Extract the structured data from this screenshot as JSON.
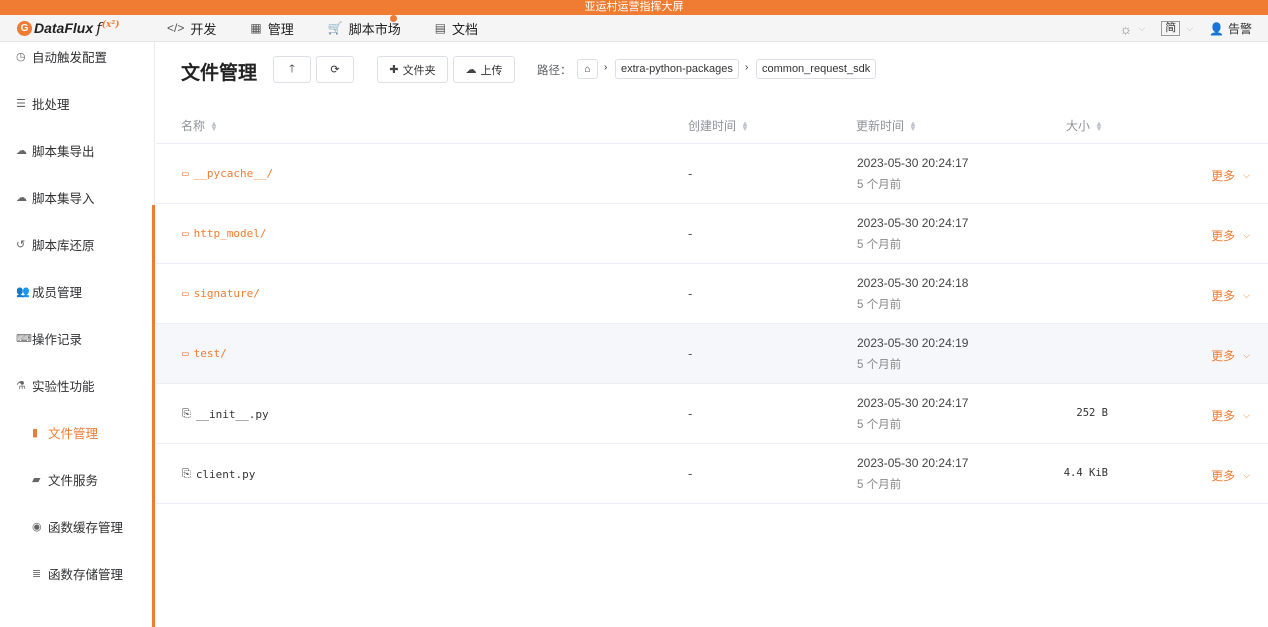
{
  "banner": "亚运村运营指挥大屏",
  "app": {
    "brand": "DataFlux",
    "fx": "f(x²)"
  },
  "nav": [
    {
      "label": "开发",
      "icon": "code-icon",
      "glyph": "</>"
    },
    {
      "label": "管理",
      "icon": "grid-icon",
      "glyph": "▦"
    },
    {
      "label": "脚本市场",
      "icon": "cart-icon",
      "glyph": "🛒"
    },
    {
      "label": "文档",
      "icon": "book-icon",
      "glyph": "▤"
    }
  ],
  "nav_right": {
    "lang": "简",
    "alert": "告警"
  },
  "sidebar": {
    "items": [
      {
        "label": "自动触发配置",
        "glyph": "◷"
      },
      {
        "label": "批处理",
        "glyph": "☰"
      },
      {
        "label": "脚本集导出",
        "glyph": "☁"
      },
      {
        "label": "脚本集导入",
        "glyph": "☁"
      },
      {
        "label": "脚本库还原",
        "glyph": "↺"
      },
      {
        "label": "成员管理",
        "glyph": "👥"
      },
      {
        "label": "操作记录",
        "glyph": "⌨"
      },
      {
        "label": "实验性功能",
        "glyph": "⚗"
      },
      {
        "label": "文件管理",
        "glyph": "▮"
      },
      {
        "label": "文件服务",
        "glyph": "▰"
      },
      {
        "label": "函数缓存管理",
        "glyph": "◉"
      },
      {
        "label": "函数存储管理",
        "glyph": "≣"
      }
    ]
  },
  "page": {
    "title": "文件管理",
    "buttons": {
      "folder": "文件夹",
      "upload": "上传"
    },
    "path_label": "路径：",
    "breadcrumb": [
      "extra-python-packages",
      "common_request_sdk"
    ]
  },
  "table": {
    "headers": {
      "name": "名称",
      "created": "创建时间",
      "updated": "更新时间",
      "size": "大小"
    },
    "more_label": "更多",
    "rows": [
      {
        "name": "__pycache__/",
        "type": "folder",
        "created": "-",
        "updated": "2023-05-30 20:24:17",
        "relative": "5 个月前",
        "size": ""
      },
      {
        "name": "http_model/",
        "type": "folder",
        "created": "-",
        "updated": "2023-05-30 20:24:17",
        "relative": "5 个月前",
        "size": ""
      },
      {
        "name": "signature/",
        "type": "folder",
        "created": "-",
        "updated": "2023-05-30 20:24:18",
        "relative": "5 个月前",
        "size": ""
      },
      {
        "name": "test/",
        "type": "folder",
        "created": "-",
        "updated": "2023-05-30 20:24:19",
        "relative": "5 个月前",
        "size": ""
      },
      {
        "name": "__init__.py",
        "type": "file",
        "created": "-",
        "updated": "2023-05-30 20:24:17",
        "relative": "5 个月前",
        "size": "252 B"
      },
      {
        "name": "client.py",
        "type": "file",
        "created": "-",
        "updated": "2023-05-30 20:24:17",
        "relative": "5 个月前",
        "size": "4.4 KiB"
      }
    ]
  },
  "colors": {
    "accent": "#f07c33"
  }
}
